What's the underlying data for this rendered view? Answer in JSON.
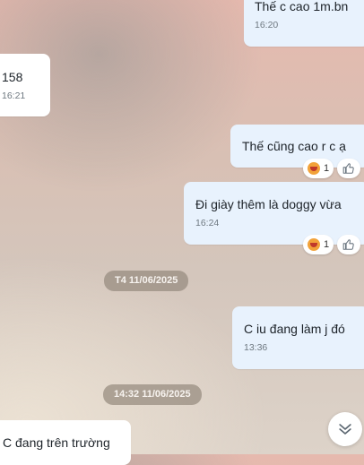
{
  "messages": [
    {
      "text": "Thế c cao 1m.bn",
      "time": "16:20"
    },
    {
      "text": "158",
      "time": "16:21"
    },
    {
      "text": "Thế cũng cao r c ạ",
      "reaction_count": "1"
    },
    {
      "text": "Đi giày thêm là doggy vừa",
      "time": "16:24",
      "reaction_count": "1"
    },
    {
      "text": "C iu đang làm j đó",
      "time": "13:36"
    },
    {
      "text": "C đang trên trường"
    }
  ],
  "date_separators": [
    "T4 11/06/2025",
    "14:32 11/06/2025"
  ],
  "icons": {
    "reaction": "laughing-emoji-icon",
    "like": "thumbs-up-icon",
    "scroll": "double-chevron-down-icon"
  },
  "colors": {
    "outgoing_bubble": "#e8f2fd",
    "incoming_bubble": "#ffffff",
    "date_pill": "#968a7e"
  }
}
